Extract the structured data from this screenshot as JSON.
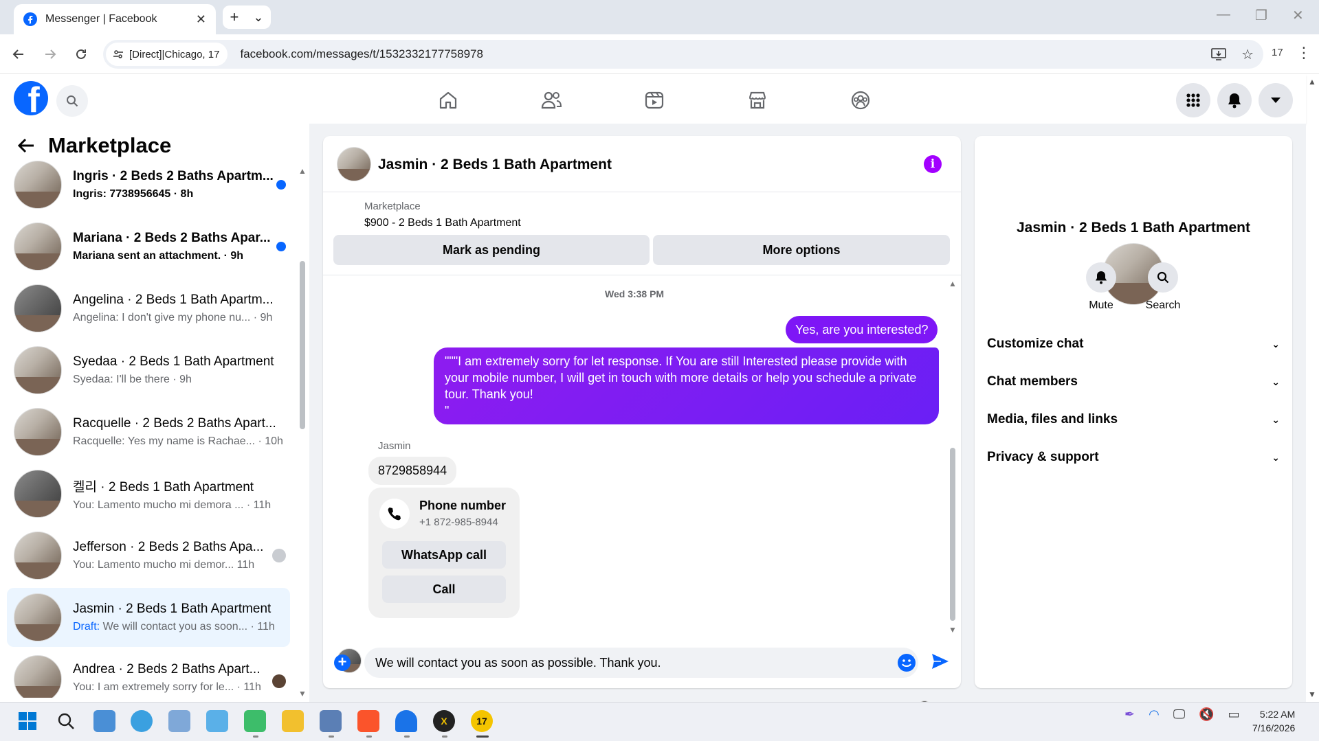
{
  "browser": {
    "tab_title": "Messenger | Facebook",
    "tab_close": "✕",
    "new_tab": "+",
    "tab_menu": "⌄",
    "site_chip": "[Direct]|Chicago, 17",
    "url": "facebook.com/messages/t/1532332177758978",
    "profile_badge": "17"
  },
  "sidebar": {
    "title": "Marketplace",
    "conversations": [
      {
        "name": "Ingris · 2 Beds 2 Baths Apartm...",
        "snippet": "Ingris: 7738956645 · 8h",
        "unread": true
      },
      {
        "name": "Mariana · 2 Beds 2 Baths Apar...",
        "snippet": "Mariana sent an attachment. · 9h",
        "unread": true
      },
      {
        "name": "Angelina · 2 Beds 1 Bath Apartm...",
        "snippet": "Angelina: I don't give my phone nu... · 9h",
        "unread": false
      },
      {
        "name": "Syedaa · 2 Beds 1 Bath Apartment",
        "snippet": "Syedaa: I'll be there · 9h",
        "unread": false
      },
      {
        "name": "Racquelle · 2 Beds 2 Baths Apart...",
        "snippet": "Racquelle: Yes my name is Rachae... · 10h",
        "unread": false
      },
      {
        "name": "켈리 · 2 Beds 1 Bath Apartment",
        "snippet": "You: Lamento mucho mi demora ... · 11h",
        "unread": false
      },
      {
        "name": "Jefferson · 2 Beds 2 Baths Apa...",
        "snippet": "You: Lamento mucho mi demor... 11h",
        "unread": false
      },
      {
        "name": "Jasmin · 2 Beds 1 Bath Apartment",
        "snippet_prefix": "Draft:",
        "snippet": " We will contact you as soon... · 11h",
        "unread": false,
        "active": true
      },
      {
        "name": "Andrea · 2 Beds 2 Baths Apart...",
        "snippet": "You: I am extremely sorry for le... · 11h",
        "unread": false
      }
    ]
  },
  "chat": {
    "title": "Jasmin · 2 Beds 1 Bath Apartment",
    "marketplace_label": "Marketplace",
    "listing": "$900 - 2 Beds 1 Bath Apartment",
    "mark_pending": "Mark as pending",
    "more_options": "More options",
    "timestamp": "Wed 3:38 PM",
    "messages": [
      {
        "from": "me",
        "text": "Yes, are you interested?"
      },
      {
        "from": "me",
        "text": "\"\"\"I am extremely sorry for let response. If You are still Interested please provide with your mobile number, I will get in touch with more details or help you schedule a private tour. Thank you!\n\""
      },
      {
        "from": "Jasmin",
        "text": "8729858944"
      }
    ],
    "sender_name": "Jasmin",
    "phone_card": {
      "title": "Phone number",
      "number": "+1 872-985-8944",
      "whatsapp": "WhatsApp call",
      "call": "Call"
    },
    "composer_text": "We will contact you as soon as possible. Thank you."
  },
  "info_panel": {
    "name": "Jasmin · 2 Beds 1 Bath Apartment",
    "mute": "Mute",
    "search": "Search",
    "rows": [
      "Customize chat",
      "Chat members",
      "Media, files and links",
      "Privacy & support"
    ]
  },
  "taskbar": {
    "time": "5:22 AM",
    "date": "7/16/2026",
    "badge": "17"
  },
  "colors": {
    "facebook_blue": "#0866ff",
    "outgoing_bubble": "#7e16f6",
    "info_accent": "#a200ff"
  }
}
